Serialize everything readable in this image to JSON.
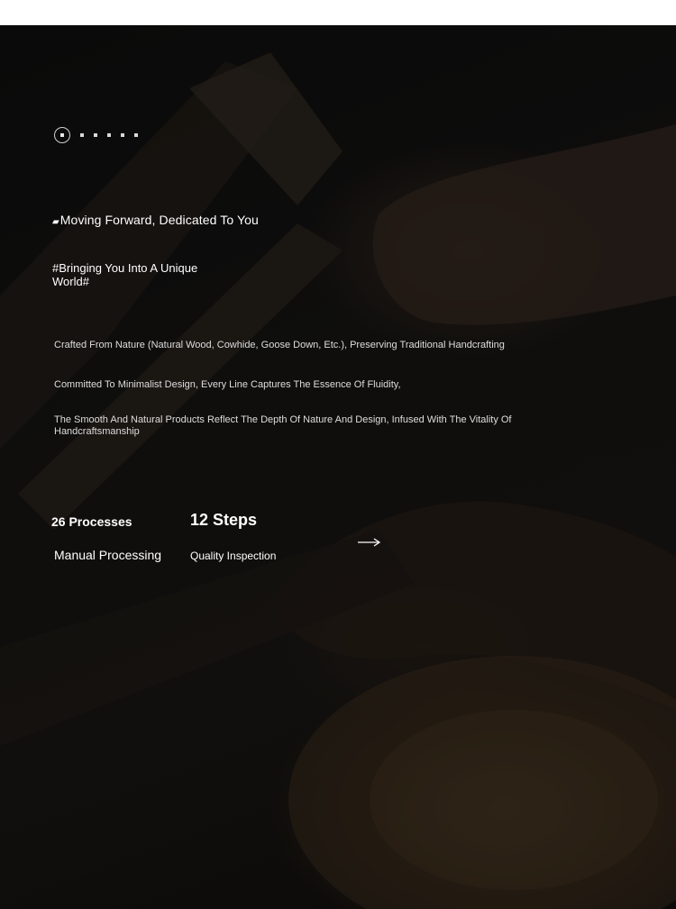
{
  "slider": {
    "dot_count": 6,
    "active_index": 0
  },
  "hero": {
    "headline_mark": "▰",
    "headline": "Moving Forward, Dedicated To You",
    "subhead": "#Bringing You Into A Unique World#",
    "paragraphs": [
      "Crafted From Nature (Natural Wood, Cowhide, Goose Down, Etc.), Preserving Traditional Handcrafting",
      "Committed To Minimalist Design, Every Line Captures The Essence Of Fluidity,",
      "The Smooth And Natural Products Reflect The Depth Of Nature And Design, Infused With The Vitality Of Handcraftsmanship"
    ]
  },
  "stats": [
    {
      "value": "26 Processes",
      "label": "Manual Processing"
    },
    {
      "value": "12 Steps",
      "label": "Quality Inspection"
    }
  ],
  "icons": {
    "next": "arrow-right-icon",
    "slider_active": "radio-dot-icon"
  },
  "colors": {
    "background": "#111111",
    "text": "#ffffff",
    "body_text": "#dedede"
  }
}
